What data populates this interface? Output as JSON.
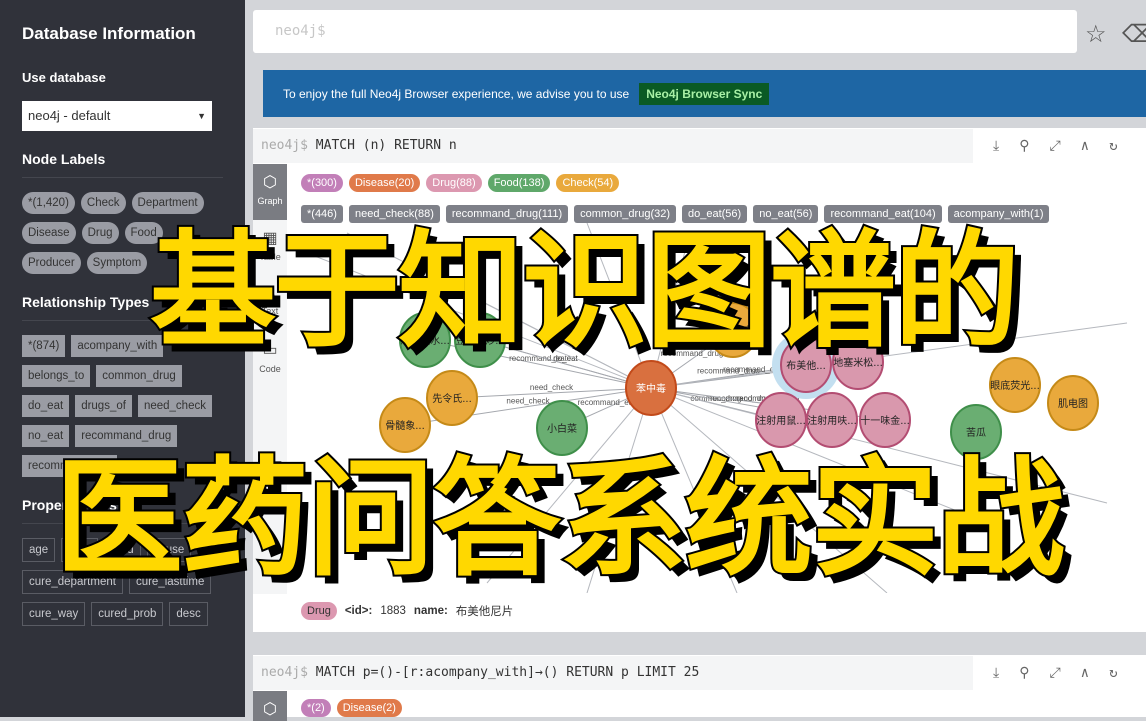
{
  "sidebar": {
    "title": "Database Information",
    "use_database": "Use database",
    "db_select": "neo4j - default",
    "node_labels_title": "Node Labels",
    "node_labels": [
      "*(1,420)",
      "Check",
      "Department",
      "Disease",
      "Drug",
      "Food",
      "Producer",
      "Symptom"
    ],
    "rel_types_title": "Relationship Types",
    "rel_types": [
      "*(874)",
      "acompany_with",
      "belongs_to",
      "common_drug",
      "do_eat",
      "drugs_of",
      "need_check",
      "no_eat",
      "recommand_drug",
      "recommand_eat"
    ],
    "prop_keys_title": "Property Keys",
    "prop_keys": [
      "age",
      "born",
      "card",
      "cause",
      "cure_department",
      "cure_lasttime",
      "cure_way",
      "cured_prob",
      "desc"
    ]
  },
  "editor": {
    "placeholder": "neo4j$"
  },
  "banner": {
    "text": "To enjoy the full Neo4j Browser experience, we advise you to use",
    "button": "Neo4j Browser Sync"
  },
  "frame1": {
    "prompt": "neo4j$",
    "query": "MATCH (n) RETURN n",
    "tabs": [
      "Graph",
      "Table",
      "Text",
      "Code"
    ],
    "labels": [
      {
        "t": "*(300)",
        "c": "#c27fb8"
      },
      {
        "t": "Disease(20)",
        "c": "#e07a4a"
      },
      {
        "t": "Drug(88)",
        "c": "#dc98b0"
      },
      {
        "t": "Food(138)",
        "c": "#5fa86a"
      },
      {
        "t": "Check(54)",
        "c": "#e9a93c"
      }
    ],
    "rels": [
      "*(446)",
      "need_check(88)",
      "recommand_drug(111)",
      "common_drug(32)",
      "do_eat(56)",
      "no_eat(56)",
      "recommand_eat(104)",
      "acompany_with(1)"
    ],
    "nodes": [
      {
        "l": "海参（水...",
        "t": "food"
      },
      {
        "l": "豆腐干炒...",
        "t": "food"
      },
      {
        "l": "先令氏...",
        "t": "check"
      },
      {
        "l": "骨髓象...",
        "t": "check"
      },
      {
        "l": "小白菜",
        "t": "food"
      },
      {
        "l": "苯中毒",
        "t": "disease"
      },
      {
        "l": "肺部检查",
        "t": "check"
      },
      {
        "l": "布美他...",
        "t": "drug"
      },
      {
        "l": "地塞米松...",
        "t": "drug"
      },
      {
        "l": "注射用鼠...",
        "t": "drug"
      },
      {
        "l": "注射用呋...",
        "t": "drug"
      },
      {
        "l": "十一味金...",
        "t": "drug"
      },
      {
        "l": "苦瓜",
        "t": "food"
      },
      {
        "l": "眼底荧光...",
        "t": "check"
      },
      {
        "l": "肌电图",
        "t": "check"
      }
    ],
    "edges": [
      "do_eat",
      "recommand_eat",
      "no_eat",
      "need_check",
      "need_check",
      "recommand_eat",
      "recommand_drug",
      "recommand_drug",
      "common_drug",
      "recommand_drug",
      "recommand_drug",
      "recommand_drug"
    ],
    "footer": {
      "label": "Drug",
      "id_key": "<id>:",
      "id_val": "1883",
      "name_key": "name:",
      "name_val": "布美他尼片"
    }
  },
  "frame2": {
    "prompt": "neo4j$",
    "query": "MATCH p=()-[r:acompany_with]→() RETURN p LIMIT 25",
    "labels": [
      {
        "t": "*(2)",
        "c": "#c27fb8"
      },
      {
        "t": "Disease(2)",
        "c": "#e07a4a"
      }
    ]
  },
  "overlay": {
    "line1": "基于知识图谱的",
    "line2": "医药问答系统实战"
  },
  "colors": {
    "food": "#6aae72",
    "check": "#e9a93c",
    "disease": "#d9703f",
    "drug": "#d998ad",
    "banner": "#1e66a4",
    "text_yellow": "#ffd800"
  }
}
